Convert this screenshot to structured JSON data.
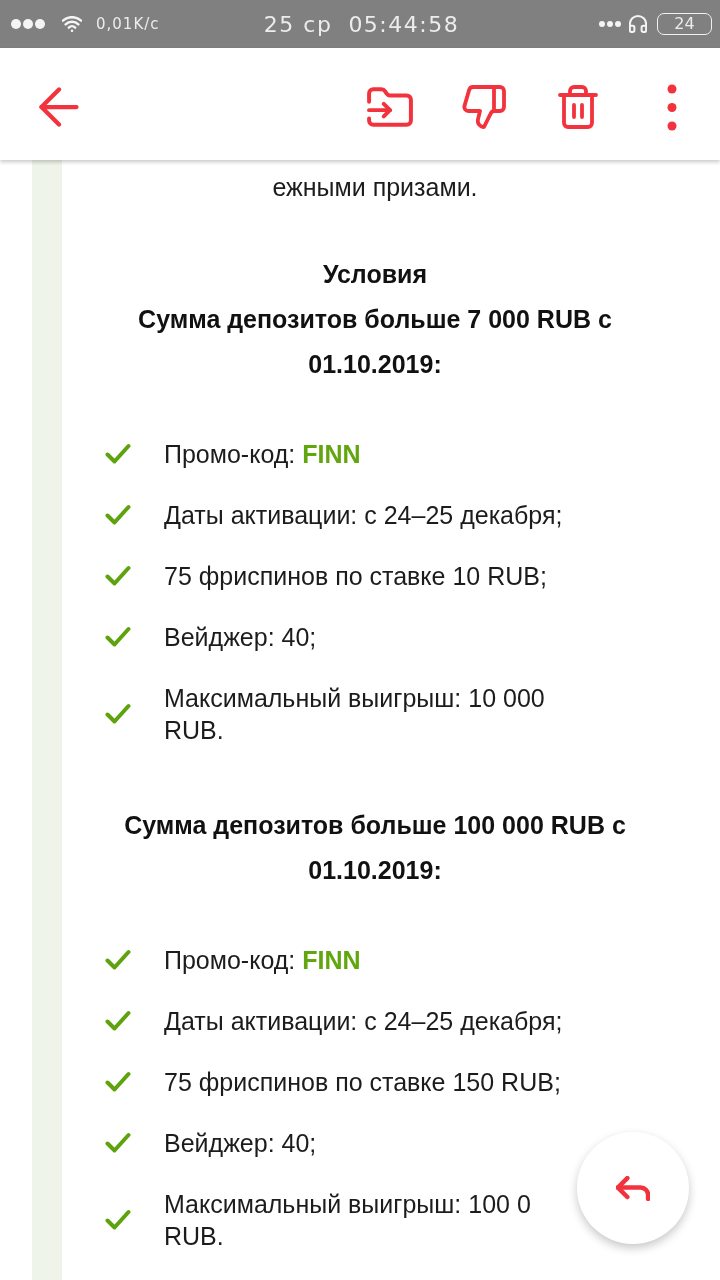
{
  "status_bar": {
    "network_speed": "0,01K/c",
    "date": "25 ср",
    "time": "05:44:58",
    "battery": "24"
  },
  "article": {
    "intro_tail": "ежными призами.",
    "heading": "Условия",
    "sections": [
      {
        "title": "Сумма депозитов больше 7 000 RUB с 01.10.2019:",
        "items": [
          "Промо-код: **FINN**",
          "Даты активации: с 24–25 декабря;",
          "75 фриспинов по ставке 10 RUB;",
          "Вейджер: 40;",
          "Максимальный выигрыш: 10 000\nRUB."
        ]
      },
      {
        "title": "Сумма депозитов больше 100 000 RUB с 01.10.2019:",
        "items": [
          "Промо-код: **FINN**",
          "Даты активации: с 24–25 декабря;",
          "75 фриспинов по ставке 150 RUB;",
          "Вейджер: 40;",
          "Максимальный выигрыш: 100 0\nRUB."
        ]
      }
    ]
  }
}
